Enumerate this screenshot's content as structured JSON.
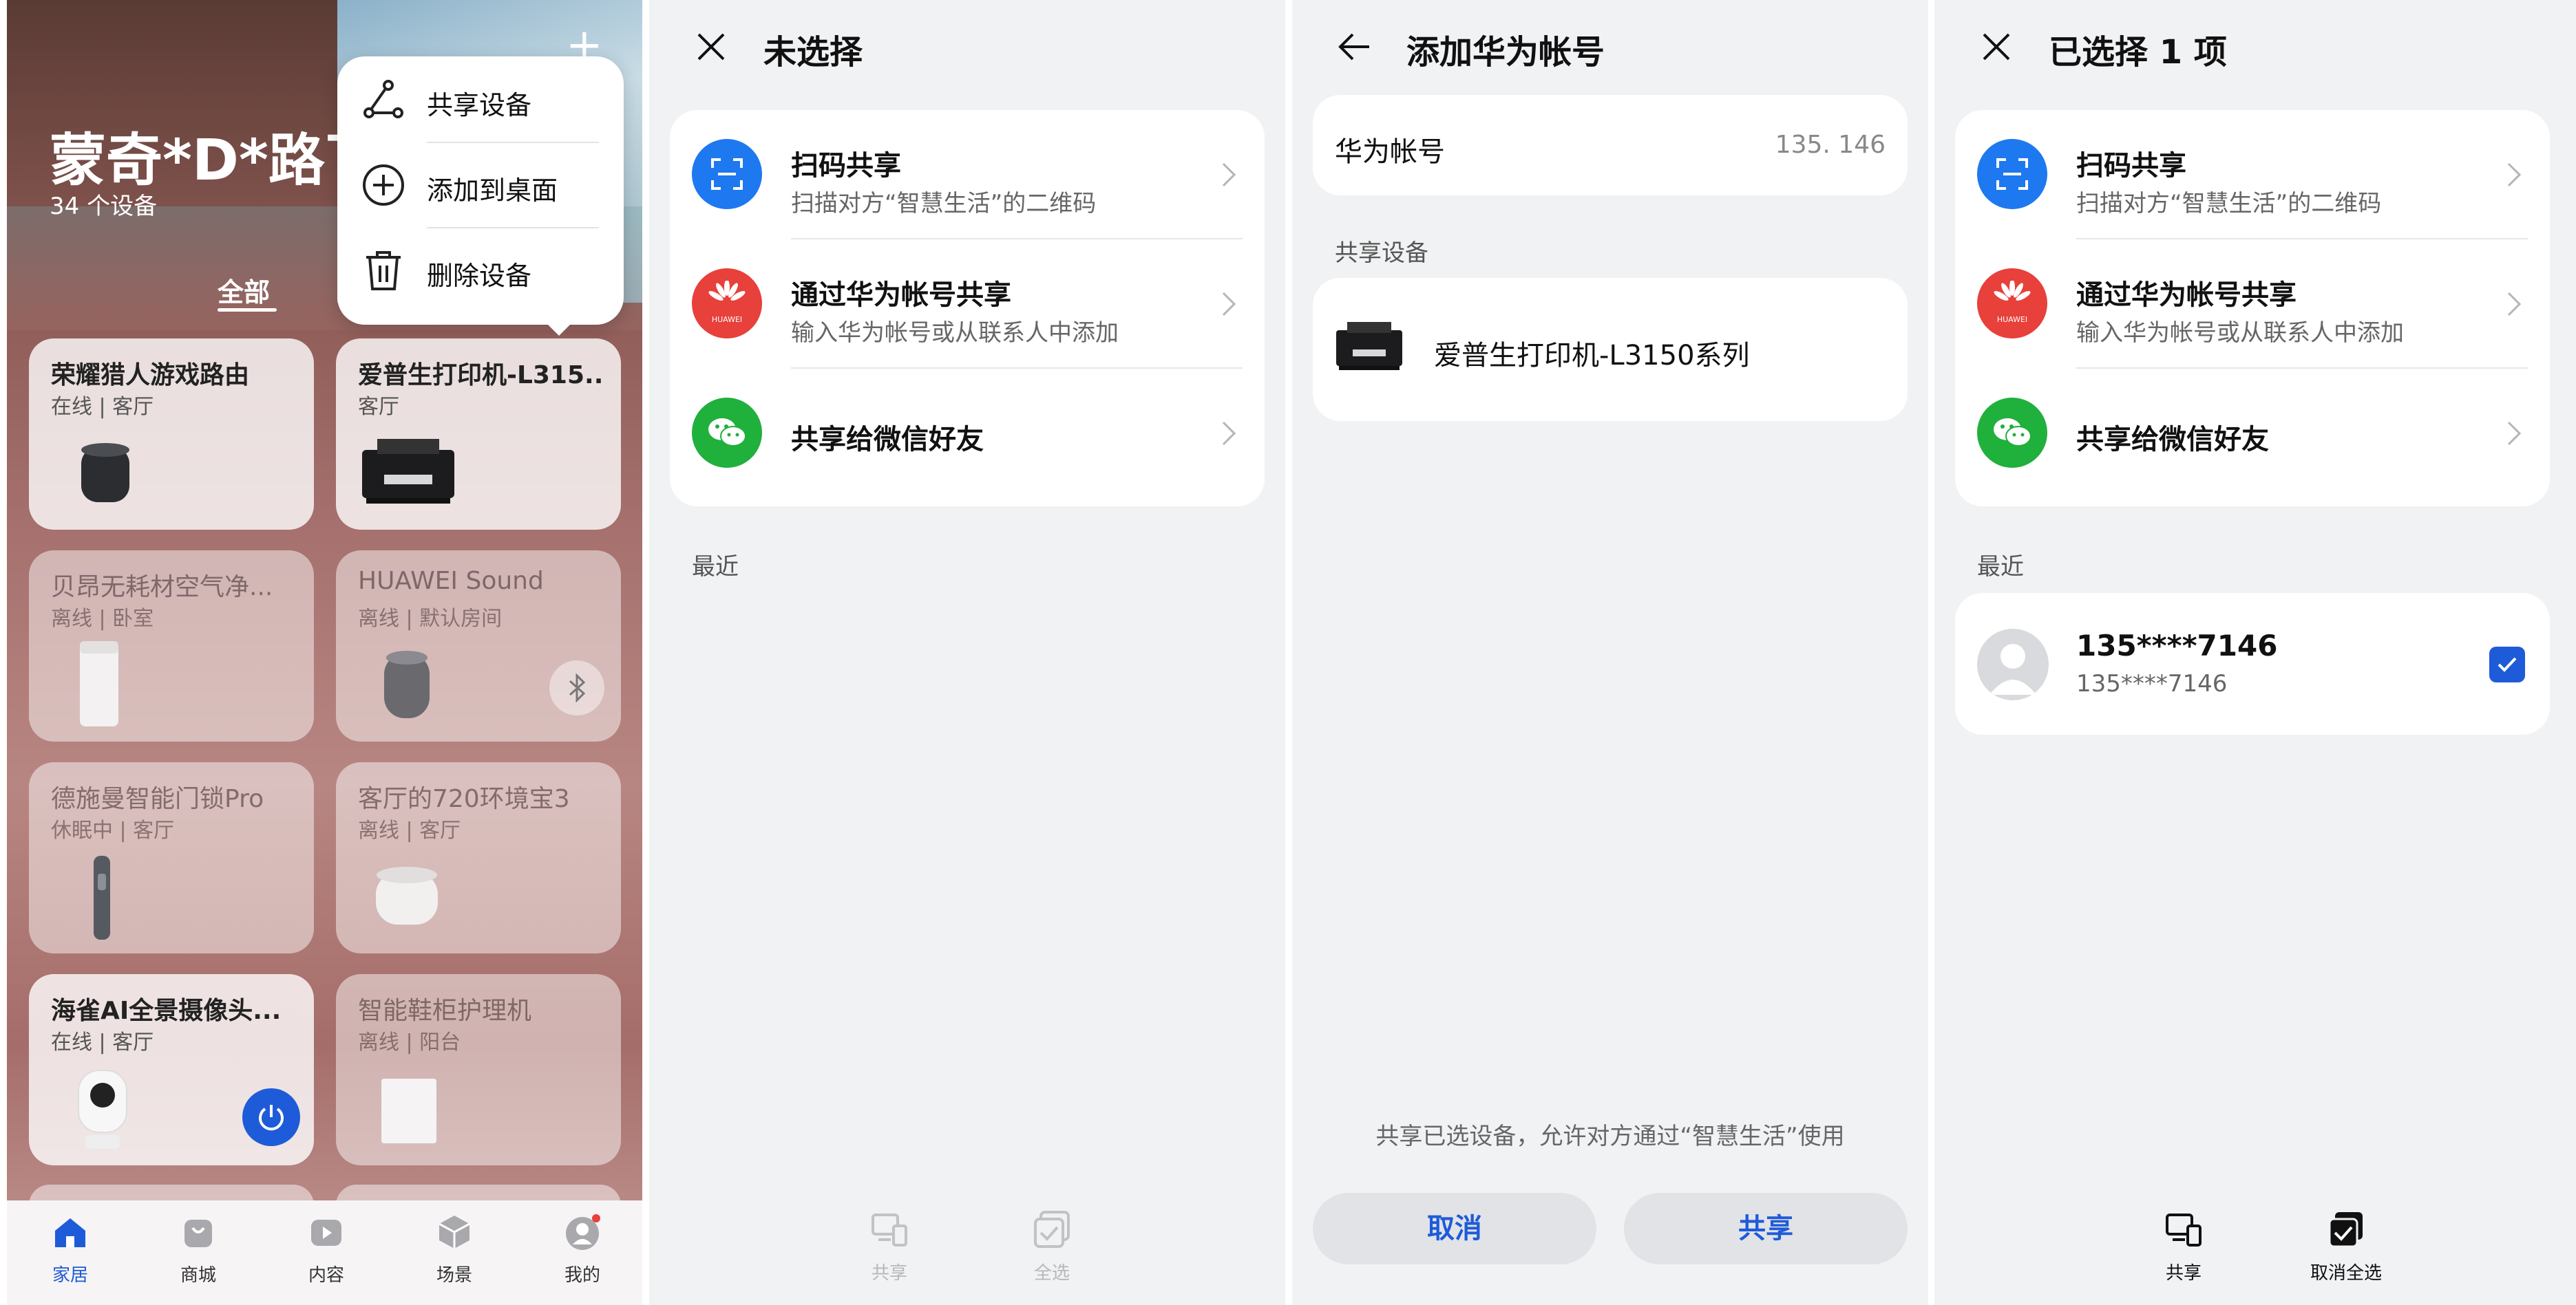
{
  "screen1": {
    "home_title": "蒙奇*D*路飞",
    "device_count": "34 个设备",
    "tab_all": "全部",
    "popup": {
      "share_device": "共享设备",
      "add_to_desktop": "添加到桌面",
      "delete_device": "删除设备"
    },
    "devices": [
      {
        "name": "荣耀猎人游戏路由",
        "status": "在线 | 客厅",
        "icon": "router-icon"
      },
      {
        "name": "爱普生打印机-L315...",
        "status": "客厅",
        "icon": "printer-icon"
      },
      {
        "name": "贝昂无耗材空气净...",
        "status": "离线 | 卧室",
        "icon": "air-purifier-icon"
      },
      {
        "name": "HUAWEI Sound",
        "status": "离线 | 默认房间",
        "icon": "speaker-icon"
      },
      {
        "name": "德施曼智能门锁Pro",
        "status": "休眠中 | 客厅",
        "icon": "door-lock-icon"
      },
      {
        "name": "客厅的720环境宝3",
        "status": "离线 | 客厅",
        "icon": "env-monitor-icon"
      },
      {
        "name": "海雀AI全景摄像头...",
        "status": "在线 | 客厅",
        "icon": "camera-icon"
      },
      {
        "name": "智能鞋柜护理机",
        "status": "离线 | 阳台",
        "icon": "shoe-cabinet-icon"
      }
    ],
    "nav": {
      "home": "家居",
      "mall": "商城",
      "content": "内容",
      "scene": "场景",
      "mine": "我的"
    },
    "accent": "#1e5bd8"
  },
  "screen2": {
    "title": "未选择",
    "scan_title": "扫码共享",
    "scan_sub": "扫描对方“智慧生活”的二维码",
    "huawei_title": "通过华为帐号共享",
    "huawei_sub": "输入华为帐号或从联系人中添加",
    "huawei_logo_text": "HUAWEI",
    "wechat_title": "共享给微信好友",
    "recent": "最近",
    "btn_share": "共享",
    "btn_select_all": "全选"
  },
  "screen3": {
    "title": "添加华为帐号",
    "account_label": "华为帐号",
    "account_value": "135.    146",
    "shared_devices_label": "共享设备",
    "device_name": "爱普生打印机-L3150系列",
    "note": "共享已选设备，允许对方通过“智慧生活”使用",
    "cancel": "取消",
    "share": "共享"
  },
  "screen4": {
    "title": "已选择 1 项",
    "scan_title": "扫码共享",
    "scan_sub": "扫描对方“智慧生活”的二维码",
    "huawei_title": "通过华为帐号共享",
    "huawei_sub": "输入华为帐号或从联系人中添加",
    "huawei_logo_text": "HUAWEI",
    "wechat_title": "共享给微信好友",
    "recent": "最近",
    "contact_name": "135****7146",
    "contact_sub": "135****7146",
    "btn_share": "共享",
    "btn_deselect_all": "取消全选"
  }
}
